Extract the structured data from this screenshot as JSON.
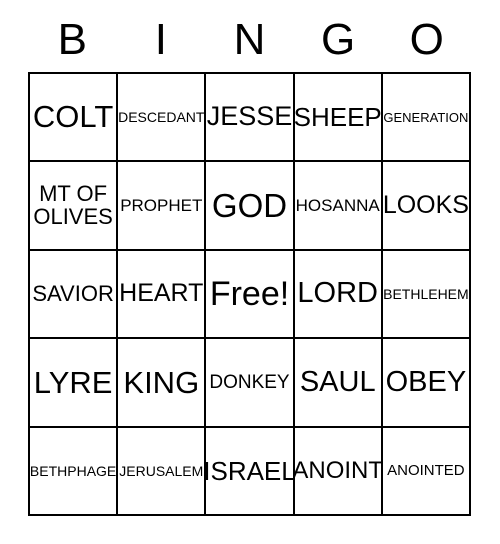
{
  "card": {
    "header": {
      "letters": [
        "B",
        "I",
        "N",
        "G",
        "O"
      ]
    },
    "grid": {
      "columns": 5,
      "rows": 5,
      "free_space_index": 12,
      "cells": [
        {
          "label": "COLT",
          "font_size": "31px"
        },
        {
          "label": "DESCEDANT",
          "font_size": "14px"
        },
        {
          "label": "JESSE",
          "font_size": "27px"
        },
        {
          "label": "SHEEP",
          "font_size": "26px"
        },
        {
          "label": "GENERATION",
          "font_size": "13px"
        },
        {
          "label": "MT OF OLIVES",
          "font_size": "22px"
        },
        {
          "label": "PROPHET",
          "font_size": "17px"
        },
        {
          "label": "GOD",
          "font_size": "33px"
        },
        {
          "label": "HOSANNA",
          "font_size": "17px"
        },
        {
          "label": "LOOKS",
          "font_size": "25px"
        },
        {
          "label": "SAVIOR",
          "font_size": "22px"
        },
        {
          "label": "HEART",
          "font_size": "25px"
        },
        {
          "label": "Free!",
          "font_size": "34px"
        },
        {
          "label": "LORD",
          "font_size": "29px"
        },
        {
          "label": "BETHLEHEM",
          "font_size": "14px"
        },
        {
          "label": "LYRE",
          "font_size": "31px"
        },
        {
          "label": "KING",
          "font_size": "31px"
        },
        {
          "label": "DONKEY",
          "font_size": "19px"
        },
        {
          "label": "SAUL",
          "font_size": "29px"
        },
        {
          "label": "OBEY",
          "font_size": "29px"
        },
        {
          "label": "BETHPHAGE",
          "font_size": "14px"
        },
        {
          "label": "JERUSALEM",
          "font_size": "14px"
        },
        {
          "label": "ISRAEL",
          "font_size": "26px"
        },
        {
          "label": "ANOINT",
          "font_size": "24px"
        },
        {
          "label": "ANOINTED",
          "font_size": "15px"
        }
      ]
    },
    "colors": {
      "background": "#ffffff",
      "text": "#000000",
      "border": "#000000"
    }
  }
}
